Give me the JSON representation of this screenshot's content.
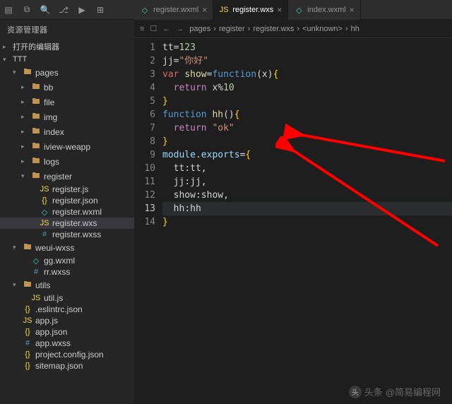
{
  "activity_icons": [
    "files",
    "copy",
    "search",
    "branch",
    "debug",
    "extensions"
  ],
  "tabs": [
    {
      "icon": "wxml",
      "label": "register.wxml",
      "active": false
    },
    {
      "icon": "wxs",
      "label": "register.wxs",
      "active": true
    },
    {
      "icon": "wxml",
      "label": "index.wxml",
      "active": false
    }
  ],
  "sidebar": {
    "title": "资源管理器",
    "sections": {
      "open_editors": "打开的编辑器",
      "project": "TTT"
    },
    "tree": [
      {
        "depth": 1,
        "chev": "▾",
        "icon": "folder",
        "label": "pages"
      },
      {
        "depth": 2,
        "chev": "▸",
        "icon": "folder",
        "label": "bb"
      },
      {
        "depth": 2,
        "chev": "▸",
        "icon": "folder",
        "label": "file"
      },
      {
        "depth": 2,
        "chev": "▸",
        "icon": "folder",
        "label": "img"
      },
      {
        "depth": 2,
        "chev": "▸",
        "icon": "folder",
        "label": "index"
      },
      {
        "depth": 2,
        "chev": "▸",
        "icon": "folder",
        "label": "iview-weapp"
      },
      {
        "depth": 2,
        "chev": "▸",
        "icon": "folder",
        "label": "logs"
      },
      {
        "depth": 2,
        "chev": "▾",
        "icon": "folder",
        "label": "register"
      },
      {
        "depth": 3,
        "chev": "",
        "icon": "js",
        "label": "register.js"
      },
      {
        "depth": 3,
        "chev": "",
        "icon": "json",
        "label": "register.json"
      },
      {
        "depth": 3,
        "chev": "",
        "icon": "wxml",
        "label": "register.wxml"
      },
      {
        "depth": 3,
        "chev": "",
        "icon": "wxs",
        "label": "register.wxs",
        "selected": true
      },
      {
        "depth": 3,
        "chev": "",
        "icon": "wxss",
        "label": "register.wxss"
      },
      {
        "depth": 1,
        "chev": "▾",
        "icon": "folder",
        "label": "weui-wxss"
      },
      {
        "depth": 2,
        "chev": "",
        "icon": "wxml",
        "label": "gg.wxml"
      },
      {
        "depth": 2,
        "chev": "",
        "icon": "wxss",
        "label": "rr.wxss"
      },
      {
        "depth": 1,
        "chev": "▾",
        "icon": "folder",
        "label": "utils"
      },
      {
        "depth": 2,
        "chev": "",
        "icon": "js",
        "label": "util.js"
      },
      {
        "depth": 1,
        "chev": "",
        "icon": "json",
        "label": ".eslintrc.json"
      },
      {
        "depth": 1,
        "chev": "",
        "icon": "js",
        "label": "app.js"
      },
      {
        "depth": 1,
        "chev": "",
        "icon": "json",
        "label": "app.json"
      },
      {
        "depth": 1,
        "chev": "",
        "icon": "wxss",
        "label": "app.wxss"
      },
      {
        "depth": 1,
        "chev": "",
        "icon": "json",
        "label": "project.config.json"
      },
      {
        "depth": 1,
        "chev": "",
        "icon": "json",
        "label": "sitemap.json"
      }
    ]
  },
  "breadcrumb": {
    "parts": [
      "pages",
      "register",
      "register.wxs",
      "<unknown>",
      "hh"
    ]
  },
  "editor": {
    "current_line": 13,
    "lines": [
      {
        "n": 1,
        "fold": "",
        "tokens": [
          [
            "ident",
            "tt"
          ],
          [
            "op",
            "="
          ],
          [
            "num",
            "123"
          ]
        ]
      },
      {
        "n": 2,
        "fold": "",
        "tokens": [
          [
            "ident",
            "jj"
          ],
          [
            "op",
            "="
          ],
          [
            "str",
            "\"你好\""
          ]
        ]
      },
      {
        "n": 3,
        "fold": "v",
        "tokens": [
          [
            "var",
            "var "
          ],
          [
            "func",
            "show"
          ],
          [
            "op",
            "="
          ],
          [
            "kw",
            "function"
          ],
          [
            "punc",
            "("
          ],
          [
            "ident",
            "x"
          ],
          [
            "punc",
            ")"
          ],
          [
            "brc",
            "{"
          ]
        ]
      },
      {
        "n": 4,
        "fold": "",
        "tokens": [
          [
            "purple",
            "  return "
          ],
          [
            "ident",
            "x"
          ],
          [
            "op",
            "%"
          ],
          [
            "num",
            "10"
          ]
        ]
      },
      {
        "n": 5,
        "fold": "",
        "tokens": [
          [
            "brc",
            "}"
          ]
        ]
      },
      {
        "n": 6,
        "fold": "v",
        "tokens": [
          [
            "kw",
            "function "
          ],
          [
            "func",
            "hh"
          ],
          [
            "punc",
            "()"
          ],
          [
            "brc",
            "{"
          ]
        ]
      },
      {
        "n": 7,
        "fold": "",
        "tokens": [
          [
            "purple",
            "  return "
          ],
          [
            "str",
            "\"ok\""
          ]
        ]
      },
      {
        "n": 8,
        "fold": "",
        "tokens": [
          [
            "brc",
            "}"
          ]
        ]
      },
      {
        "n": 9,
        "fold": "v",
        "tokens": [
          [
            "prop",
            "module"
          ],
          [
            "punc",
            "."
          ],
          [
            "prop",
            "exports"
          ],
          [
            "op",
            "="
          ],
          [
            "brc",
            "{"
          ]
        ]
      },
      {
        "n": 10,
        "fold": "",
        "tokens": [
          [
            "ident",
            "  tt"
          ],
          [
            "punc",
            ":"
          ],
          [
            "ident",
            "tt"
          ],
          [
            "punc",
            ","
          ]
        ]
      },
      {
        "n": 11,
        "fold": "",
        "tokens": [
          [
            "ident",
            "  jj"
          ],
          [
            "punc",
            ":"
          ],
          [
            "ident",
            "jj"
          ],
          [
            "punc",
            ","
          ]
        ]
      },
      {
        "n": 12,
        "fold": "",
        "tokens": [
          [
            "ident",
            "  show"
          ],
          [
            "punc",
            ":"
          ],
          [
            "ident",
            "show"
          ],
          [
            "punc",
            ","
          ]
        ]
      },
      {
        "n": 13,
        "fold": "",
        "tokens": [
          [
            "ident",
            "  hh"
          ],
          [
            "punc",
            ":"
          ],
          [
            "ident",
            "hh"
          ]
        ]
      },
      {
        "n": 14,
        "fold": "",
        "tokens": [
          [
            "brc",
            "}"
          ]
        ]
      }
    ]
  },
  "watermark": {
    "brand": "头条",
    "text": "@简易编程网"
  }
}
